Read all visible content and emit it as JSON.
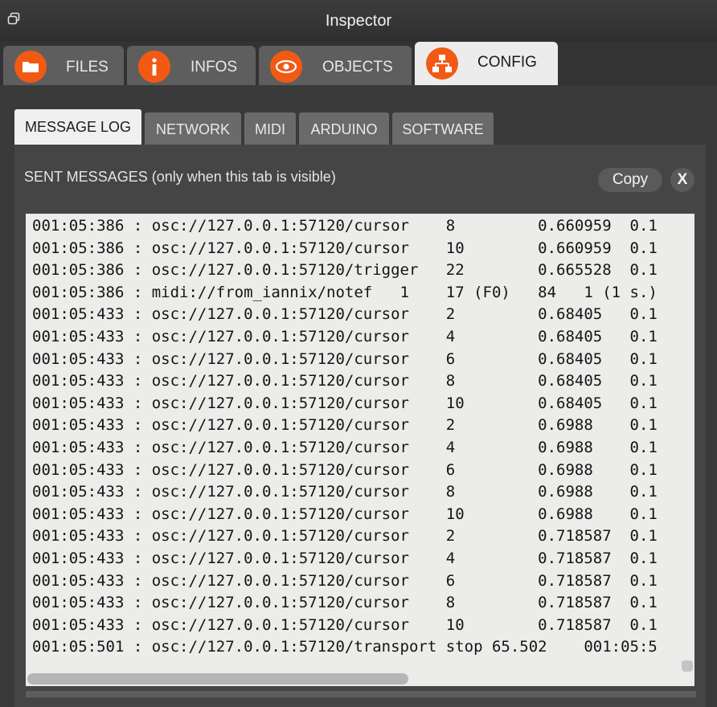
{
  "window": {
    "title": "Inspector"
  },
  "main_tabs": [
    {
      "label": "FILES",
      "icon": "folder-icon"
    },
    {
      "label": "INFOS",
      "icon": "info-icon"
    },
    {
      "label": "OBJECTS",
      "icon": "eye-icon"
    },
    {
      "label": "CONFIG",
      "icon": "network-icon",
      "active": true
    }
  ],
  "sub_tabs": [
    {
      "label": "MESSAGE LOG",
      "active": true
    },
    {
      "label": "NETWORK"
    },
    {
      "label": "MIDI"
    },
    {
      "label": "ARDUINO"
    },
    {
      "label": "SOFTWARE"
    }
  ],
  "log_panel": {
    "heading": "SENT MESSAGES (only when this tab is visible)",
    "copy_label": "Copy",
    "close_label": "X",
    "lines": [
      "001:05:386 : osc://127.0.0.1:57120/cursor    8         0.660959  0.1",
      "001:05:386 : osc://127.0.0.1:57120/cursor    10        0.660959  0.1",
      "001:05:386 : osc://127.0.0.1:57120/trigger   22        0.665528  0.1",
      "001:05:386 : midi://from_iannix/notef   1    17 (F0)   84   1 (1 s.)",
      "001:05:433 : osc://127.0.0.1:57120/cursor    2         0.68405   0.1",
      "001:05:433 : osc://127.0.0.1:57120/cursor    4         0.68405   0.1",
      "001:05:433 : osc://127.0.0.1:57120/cursor    6         0.68405   0.1",
      "001:05:433 : osc://127.0.0.1:57120/cursor    8         0.68405   0.1",
      "001:05:433 : osc://127.0.0.1:57120/cursor    10        0.68405   0.1",
      "001:05:433 : osc://127.0.0.1:57120/cursor    2         0.6988    0.1",
      "001:05:433 : osc://127.0.0.1:57120/cursor    4         0.6988    0.1",
      "001:05:433 : osc://127.0.0.1:57120/cursor    6         0.6988    0.1",
      "001:05:433 : osc://127.0.0.1:57120/cursor    8         0.6988    0.1",
      "001:05:433 : osc://127.0.0.1:57120/cursor    10        0.6988    0.1",
      "001:05:433 : osc://127.0.0.1:57120/cursor    2         0.718587  0.1",
      "001:05:433 : osc://127.0.0.1:57120/cursor    4         0.718587  0.1",
      "001:05:433 : osc://127.0.0.1:57120/cursor    6         0.718587  0.1",
      "001:05:433 : osc://127.0.0.1:57120/cursor    8         0.718587  0.1",
      "001:05:433 : osc://127.0.0.1:57120/cursor    10        0.718587  0.1",
      "001:05:501 : osc://127.0.0.1:57120/transport stop 65.502    001:05:5"
    ]
  },
  "colors": {
    "accent": "#f25a14",
    "background": "#333333",
    "active_tab": "#ececec"
  }
}
